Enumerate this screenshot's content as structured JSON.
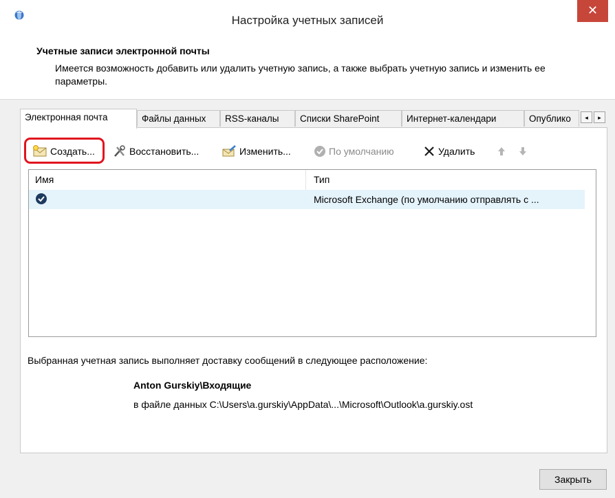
{
  "window": {
    "title": "Настройка учетных записей",
    "close_glyph": "✕",
    "close_color": "#c7463a"
  },
  "header": {
    "heading": "Учетные записи электронной почты",
    "description": "Имеется возможность добавить или удалить учетную запись, а также выбрать учетную запись и изменить ее параметры."
  },
  "tabs": [
    {
      "label": "Электронная почта",
      "active": true
    },
    {
      "label": "Файлы данных",
      "active": false
    },
    {
      "label": "RSS-каналы",
      "active": false
    },
    {
      "label": "Списки SharePoint",
      "active": false
    },
    {
      "label": "Интернет-календари",
      "active": false
    },
    {
      "label": "Опублико",
      "active": false
    }
  ],
  "tab_scroll": {
    "left": "◂",
    "right": "▸"
  },
  "toolbar": {
    "create_label": "Создать...",
    "repair_label": "Восстановить...",
    "change_label": "Изменить...",
    "default_label": "По умолчанию",
    "delete_label": "Удалить",
    "icons": [
      "new-mail-icon",
      "repair-tools-icon",
      "edit-mail-icon",
      "check-circle-icon",
      "delete-x-icon",
      "arrow-up-icon",
      "arrow-down-icon"
    ],
    "highlight_color": "#e0141e"
  },
  "list": {
    "columns": [
      "Имя",
      "Тип"
    ],
    "rows": [
      {
        "name": "",
        "type": "Microsoft Exchange (по умолчанию отправлять с ...",
        "selected": true
      }
    ],
    "selection_color": "#e5f3fb"
  },
  "delivery": {
    "text": "Выбранная учетная запись выполняет доставку сообщений в следующее расположение:",
    "mailbox": "Anton Gurskiy\\Входящие",
    "path": "в файле данных C:\\Users\\a.gurskiy\\AppData\\...\\Microsoft\\Outlook\\a.gurskiy.ost"
  },
  "footer": {
    "close_label": "Закрыть"
  }
}
